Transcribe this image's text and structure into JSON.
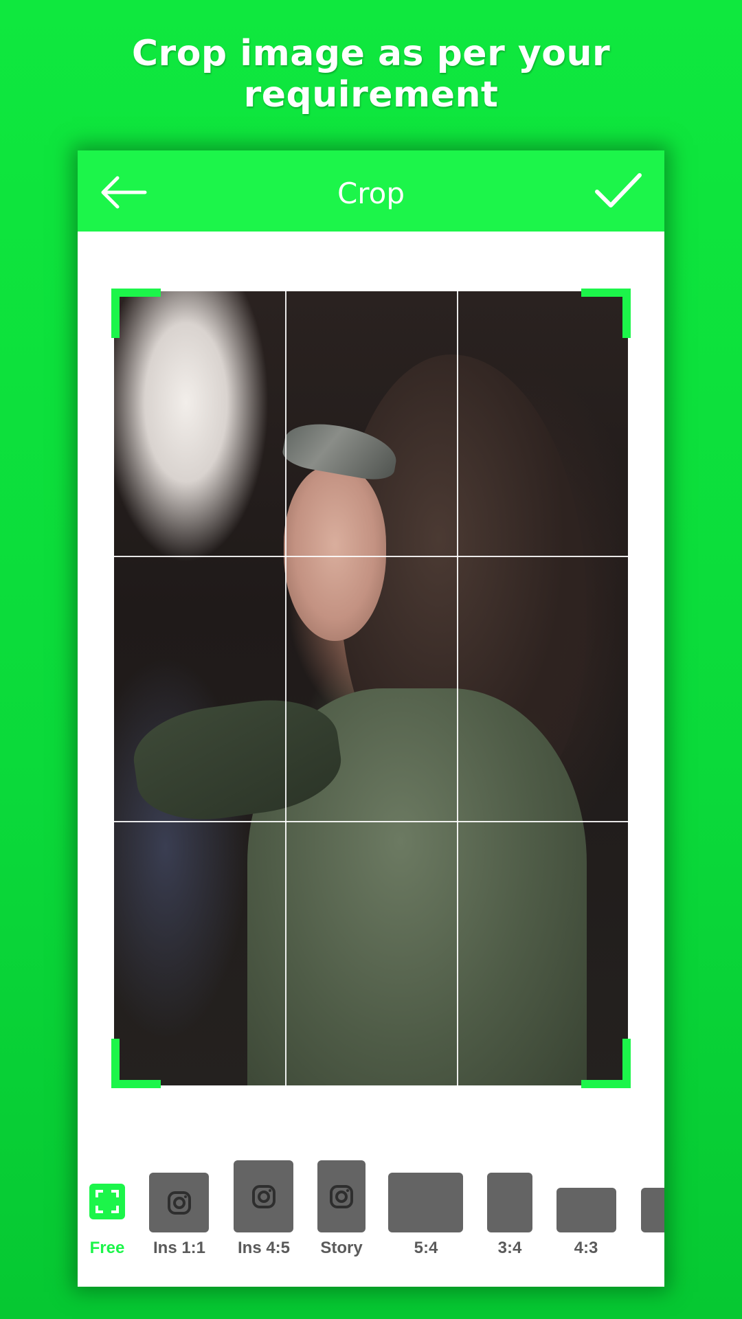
{
  "headline": "Crop image as per your requirement",
  "appbar": {
    "title": "Crop",
    "back_icon": "arrow-left-icon",
    "confirm_icon": "checkmark-icon"
  },
  "crop": {
    "grid": "rule-of-thirds",
    "image_description": "Portrait of a woman with curly dark hair, headband and olive green shirt"
  },
  "ratios": [
    {
      "label": "Free",
      "icon": "free-crop-icon",
      "active": true
    },
    {
      "label": "Ins 1:1",
      "icon": "instagram-icon",
      "active": false
    },
    {
      "label": "Ins 4:5",
      "icon": "instagram-icon",
      "active": false
    },
    {
      "label": "Story",
      "icon": "instagram-icon",
      "active": false
    },
    {
      "label": "5:4",
      "icon": "",
      "active": false
    },
    {
      "label": "3:4",
      "icon": "",
      "active": false
    },
    {
      "label": "4:3",
      "icon": "",
      "active": false
    },
    {
      "label": "",
      "icon": "",
      "active": false
    }
  ],
  "colors": {
    "accent": "#1cf54a",
    "background": "#0fe83e",
    "thumb": "#646464",
    "label": "#5a5a5a"
  }
}
